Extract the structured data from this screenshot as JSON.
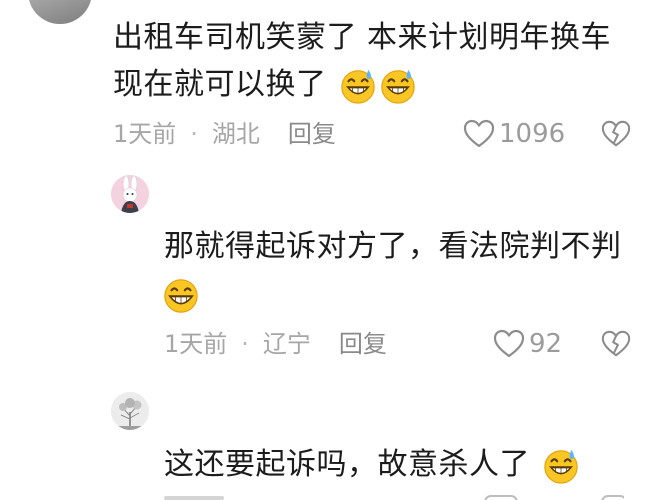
{
  "comments": [
    {
      "text": "出租车司机笑蒙了 本来计划明年换车",
      "text_line2": "现在就可以换了",
      "emojis": [
        "grin-sweat-emoji",
        "grin-sweat-emoji"
      ],
      "time": "1天前",
      "location": "湖北",
      "reply_label": "回复",
      "likes": "1096"
    },
    {
      "text": "那就得起诉对方了，看法院判不判",
      "emojis": [
        "grin-emoji"
      ],
      "time": "1天前",
      "location": "辽宁",
      "reply_label": "回复",
      "likes": "92"
    },
    {
      "text": "这还要起诉吗，故意杀人了",
      "emojis": [
        "grin-sweat-emoji"
      ]
    }
  ],
  "meta_separator": "·",
  "colors": {
    "text": "#1c1c1c",
    "meta": "#a6a6a6",
    "emoji_face": "#f9c623",
    "sweat": "#5ab4ff"
  }
}
